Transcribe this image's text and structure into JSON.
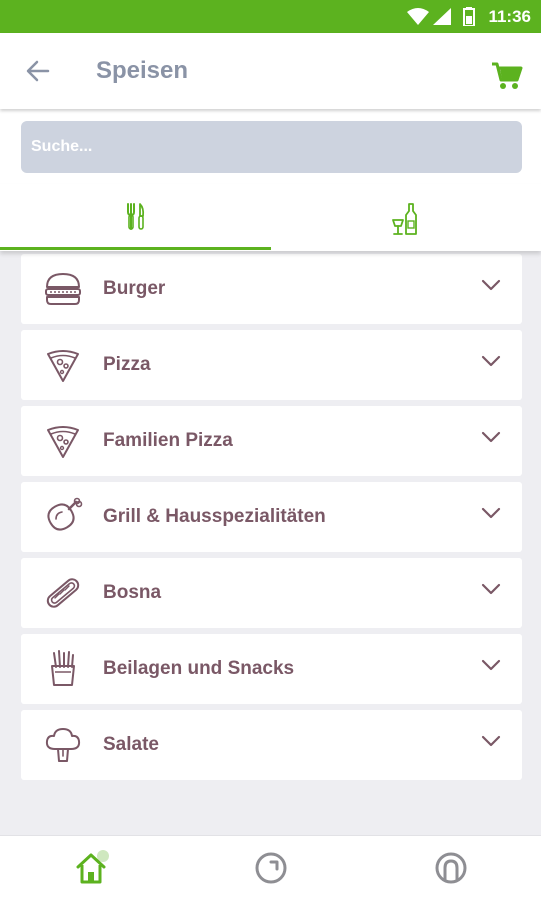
{
  "status_bar": {
    "time": "11:36"
  },
  "app_bar": {
    "title": "Speisen"
  },
  "search": {
    "placeholder": "Suche..."
  },
  "categories": [
    {
      "label": "Burger",
      "icon": "burger-icon"
    },
    {
      "label": "Pizza",
      "icon": "pizza-slice-icon"
    },
    {
      "label": "Familien Pizza",
      "icon": "pizza-slice-icon"
    },
    {
      "label": "Grill & Hausspezialitäten",
      "icon": "meat-leg-icon"
    },
    {
      "label": "Bosna",
      "icon": "hotdog-icon"
    },
    {
      "label": "Beilagen und Snacks",
      "icon": "fries-icon"
    },
    {
      "label": "Salate",
      "icon": "broccoli-icon"
    }
  ],
  "tabs": [
    {
      "icon": "cutlery-icon",
      "active": true
    },
    {
      "icon": "drinks-icon",
      "active": false
    }
  ],
  "bottom_nav": [
    {
      "icon": "home-icon",
      "active": true
    },
    {
      "icon": "history-icon"
    },
    {
      "icon": "profile-icon"
    }
  ],
  "colors": {
    "accent": "#5cb21f",
    "title": "#8a93a6",
    "item_text": "#7a5866",
    "search_bg": "#cdd3df",
    "background": "#eeeef2"
  }
}
